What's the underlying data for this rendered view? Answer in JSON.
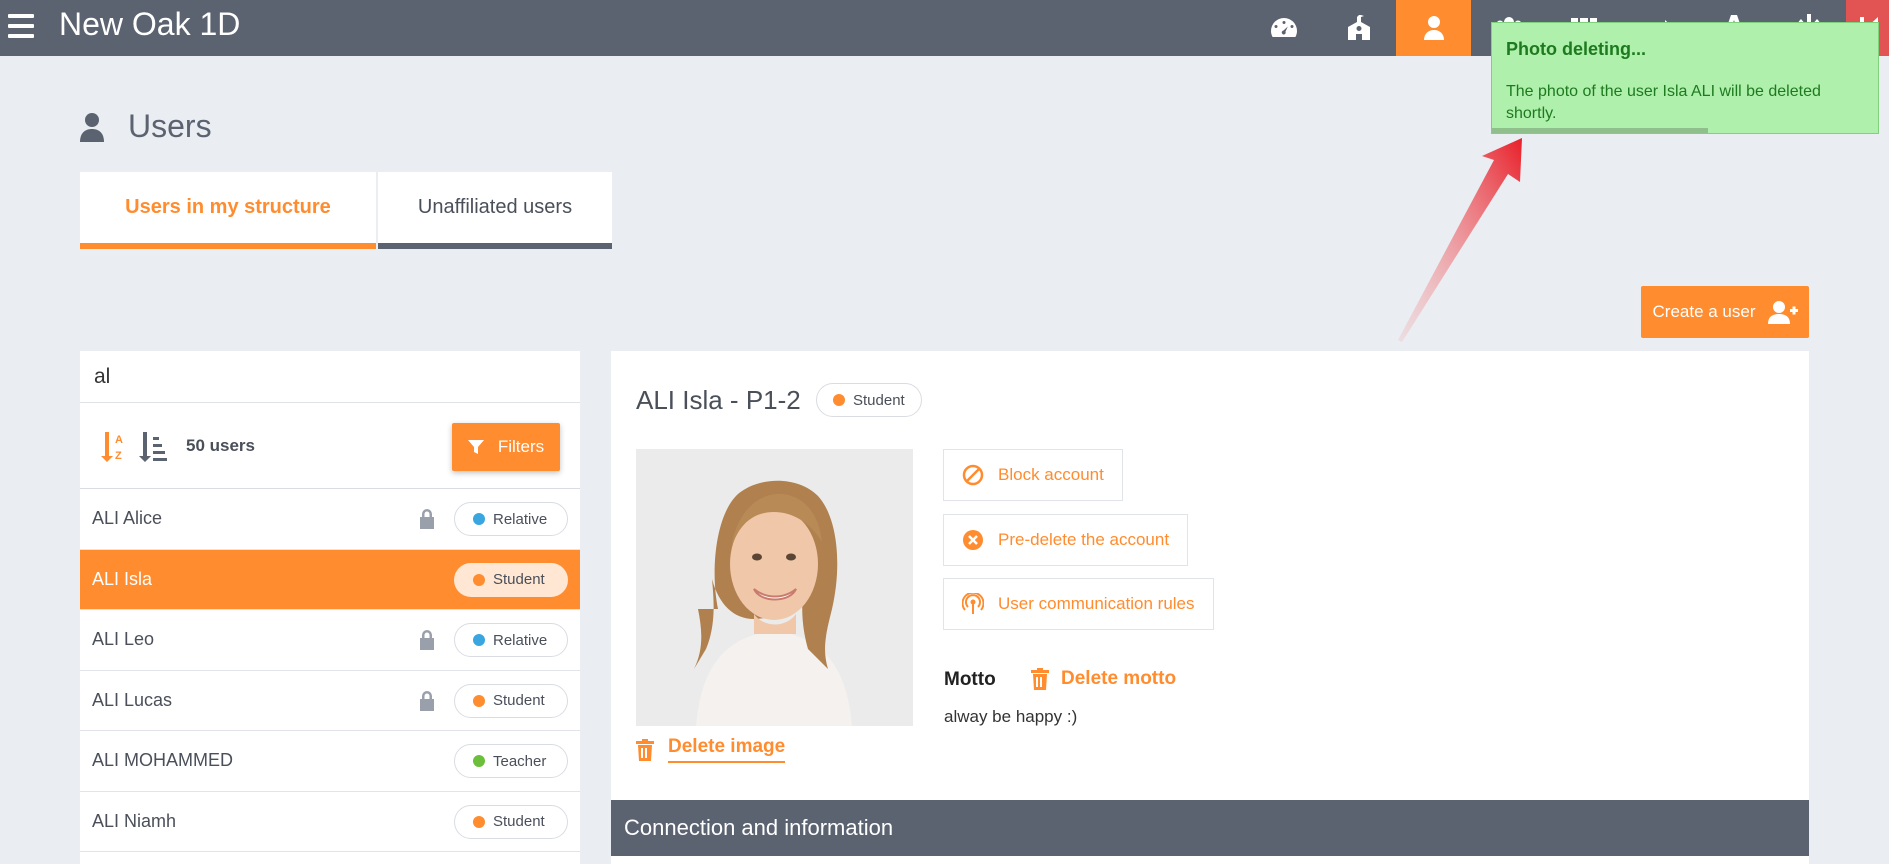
{
  "header": {
    "app_title": "New Oak 1D",
    "nav": [
      {
        "icon": "dashboard-icon"
      },
      {
        "icon": "school-icon"
      },
      {
        "icon": "user-icon",
        "active": true
      },
      {
        "icon": "groups-icon"
      },
      {
        "icon": "apps-grid-icon"
      },
      {
        "icon": "arrow-right-icon"
      },
      {
        "icon": "font-icon"
      },
      {
        "icon": "power-icon"
      },
      {
        "icon": "logout-icon"
      }
    ]
  },
  "page": {
    "title": "Users",
    "tabs": [
      {
        "label": "Users in my structure",
        "active": true
      },
      {
        "label": "Unaffiliated users"
      }
    ],
    "create_user_label": "Create a user"
  },
  "list": {
    "search_value": "al",
    "users_count": "50 users",
    "filters_label": "Filters",
    "rows": [
      {
        "name": "ALI Alice",
        "profile": "Relative",
        "locked": true
      },
      {
        "name": "ALI Isla",
        "profile": "Student",
        "locked": false,
        "selected": true
      },
      {
        "name": "ALI Leo",
        "profile": "Relative",
        "locked": true
      },
      {
        "name": "ALI Lucas",
        "profile": "Student",
        "locked": true
      },
      {
        "name": "ALI MOHAMMED",
        "profile": "Teacher",
        "locked": false
      },
      {
        "name": "ALI Niamh",
        "profile": "Student",
        "locked": false
      }
    ]
  },
  "detail": {
    "title": "ALI Isla - P1-2",
    "profile": "Student",
    "delete_image_label": "Delete image",
    "actions": {
      "block": "Block account",
      "predelete": "Pre-delete the account",
      "communication": "User communication rules"
    },
    "motto_label": "Motto",
    "delete_motto_label": "Delete motto",
    "motto_text": "alway be happy :)",
    "section_title": "Connection and information"
  },
  "toast": {
    "title": "Photo deleting...",
    "message": "The photo of the user Isla ALI will be deleted shortly.",
    "progress": 0.56
  },
  "colors": {
    "accent": "#ff8c2e",
    "header_bg": "#5b6270",
    "relative": "#3aa6e0",
    "student": "#ff8c2e",
    "teacher": "#6cbf3a",
    "toast_bg": "#aff0ad"
  }
}
